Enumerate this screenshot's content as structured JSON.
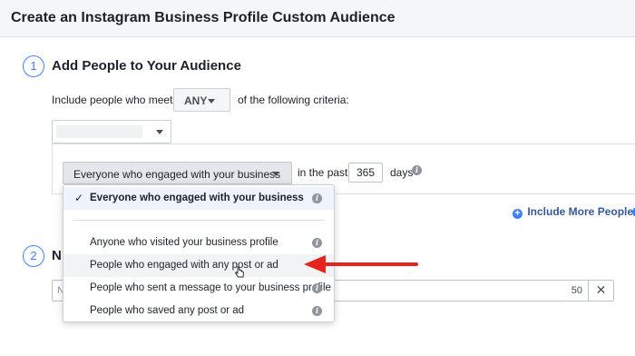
{
  "header": {
    "title": "Create an Instagram Business Profile Custom Audience"
  },
  "section1": {
    "number": "1",
    "title": "Add People to Your Audience",
    "include_prefix": "Include people who meet",
    "match_value": "ANY",
    "include_suffix": "of the following criteria:",
    "engagement_select": "Everyone who engaged with your business",
    "in_the_past": "in the past",
    "days_value": "365",
    "days_label": "days",
    "include_more_link": "Include More People"
  },
  "dropdown": {
    "selected": "Everyone who engaged with your business",
    "options": [
      "Anyone who visited your business profile",
      "People who engaged with any post or ad",
      "People who sent a message to your business profile",
      "People who saved any post or ad"
    ]
  },
  "section2": {
    "number": "2",
    "title_partial": "N",
    "name_prefix": "N",
    "char_count": "50",
    "clear_label": "✕"
  },
  "colors": {
    "accent": "#4080ff",
    "annotation_arrow": "#e8231b",
    "link": "#365899"
  },
  "icons": [
    "info-icon",
    "chevron-down-icon",
    "check-icon",
    "plus-circle-icon",
    "close-icon",
    "hand-cursor-icon",
    "red-arrow-annotation"
  ]
}
